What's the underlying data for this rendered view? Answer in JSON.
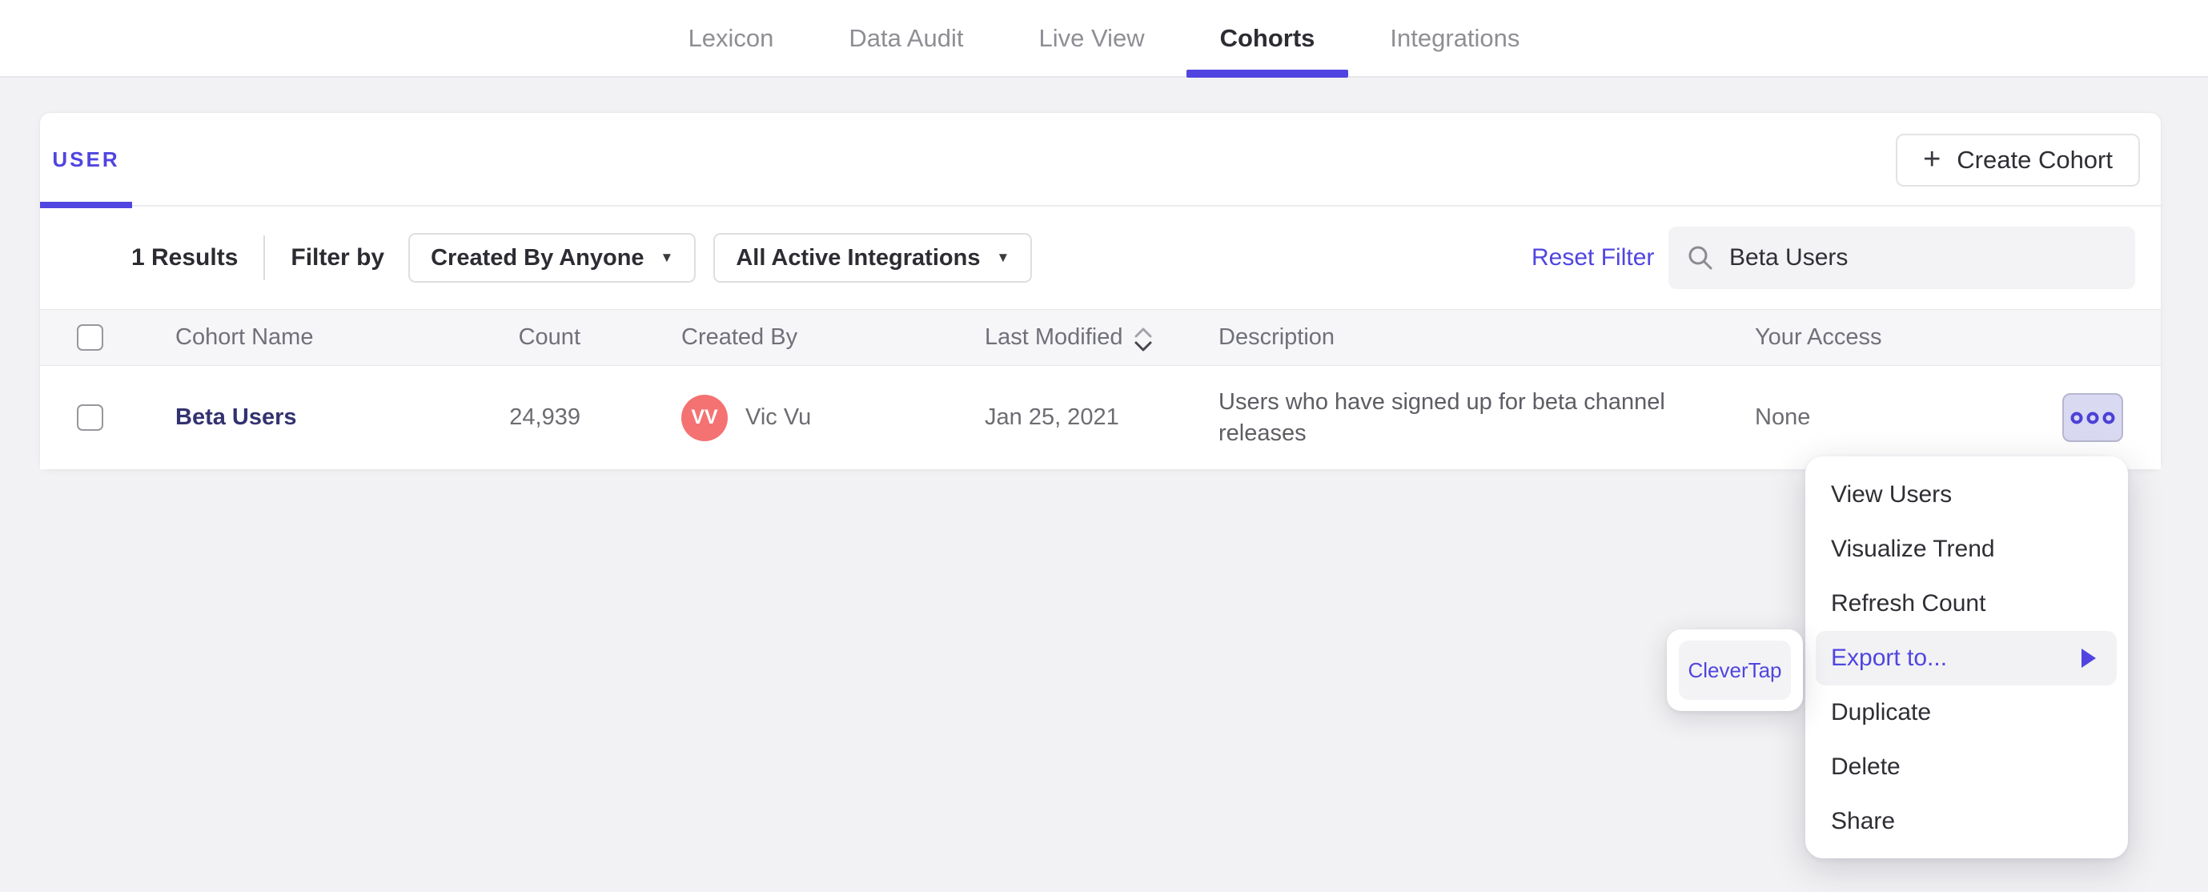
{
  "accent_color": "#5045e0",
  "icons": {
    "plus": "+",
    "caret_down": "▼"
  },
  "nav": {
    "items": [
      {
        "label": "Lexicon",
        "active": false
      },
      {
        "label": "Data Audit",
        "active": false
      },
      {
        "label": "Live View",
        "active": false
      },
      {
        "label": "Cohorts",
        "active": true
      },
      {
        "label": "Integrations",
        "active": false
      }
    ]
  },
  "card": {
    "tab_label": "USER",
    "create_button_label": "Create Cohort",
    "filters": {
      "results": "1 Results",
      "filter_by": "Filter by",
      "created_by_dropdown": "Created By Anyone",
      "integrations_dropdown": "All Active Integrations",
      "reset": "Reset Filter",
      "search_value": "Beta Users"
    },
    "table": {
      "columns": {
        "name": "Cohort Name",
        "count": "Count",
        "created_by": "Created By",
        "last_modified": "Last Modified",
        "description": "Description",
        "access": "Your Access"
      },
      "row": {
        "name": "Beta Users",
        "count": "24,939",
        "creator_initials": "VV",
        "creator_name": "Vic Vu",
        "avatar_color": "#f47272",
        "last_modified": "Jan 25, 2021",
        "description": "Users who have signed up for beta channel releases",
        "access": "None"
      }
    }
  },
  "menu": {
    "items": [
      {
        "label": "View Users"
      },
      {
        "label": "Visualize Trend"
      },
      {
        "label": "Refresh Count"
      },
      {
        "label": "Export to...",
        "highlighted": true,
        "has_submenu": true
      },
      {
        "label": "Duplicate"
      },
      {
        "label": "Delete"
      },
      {
        "label": "Share"
      }
    ]
  },
  "submenu": {
    "items": [
      {
        "label": "CleverTap"
      }
    ]
  }
}
